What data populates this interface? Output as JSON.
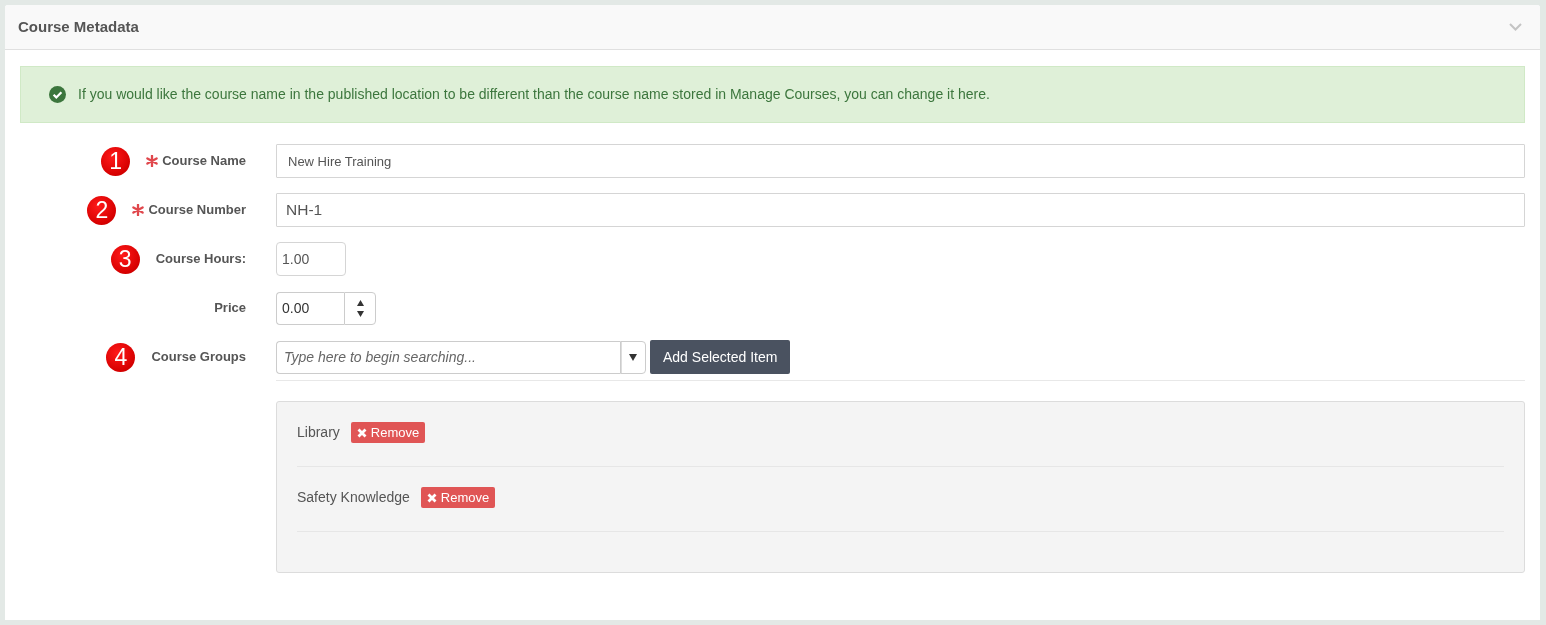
{
  "panel": {
    "title": "Course Metadata"
  },
  "alert": {
    "message": "If you would like the course name in the published location to be different than the course name stored in Manage Courses, you can change it here."
  },
  "fields": [
    {
      "kind": "text",
      "marker": "1",
      "required": true,
      "label": "Course Name",
      "value": "New Hire Training"
    },
    {
      "kind": "text",
      "marker": "2",
      "required": true,
      "label": "Course Number",
      "value": "NH-1"
    },
    {
      "kind": "short",
      "marker": "3",
      "required": false,
      "label": "Course Hours:",
      "value": "1.00"
    },
    {
      "kind": "spinner",
      "required": false,
      "label": "Price",
      "value": "0.00"
    },
    {
      "kind": "combobox",
      "marker": "4",
      "required": false,
      "label": "Course Groups",
      "placeholder": "Type here to begin searching...",
      "button": "Add Selected Item"
    }
  ],
  "course_groups": [
    {
      "name": "Library",
      "action": "Remove"
    },
    {
      "name": "Safety Knowledge",
      "action": "Remove"
    }
  ]
}
